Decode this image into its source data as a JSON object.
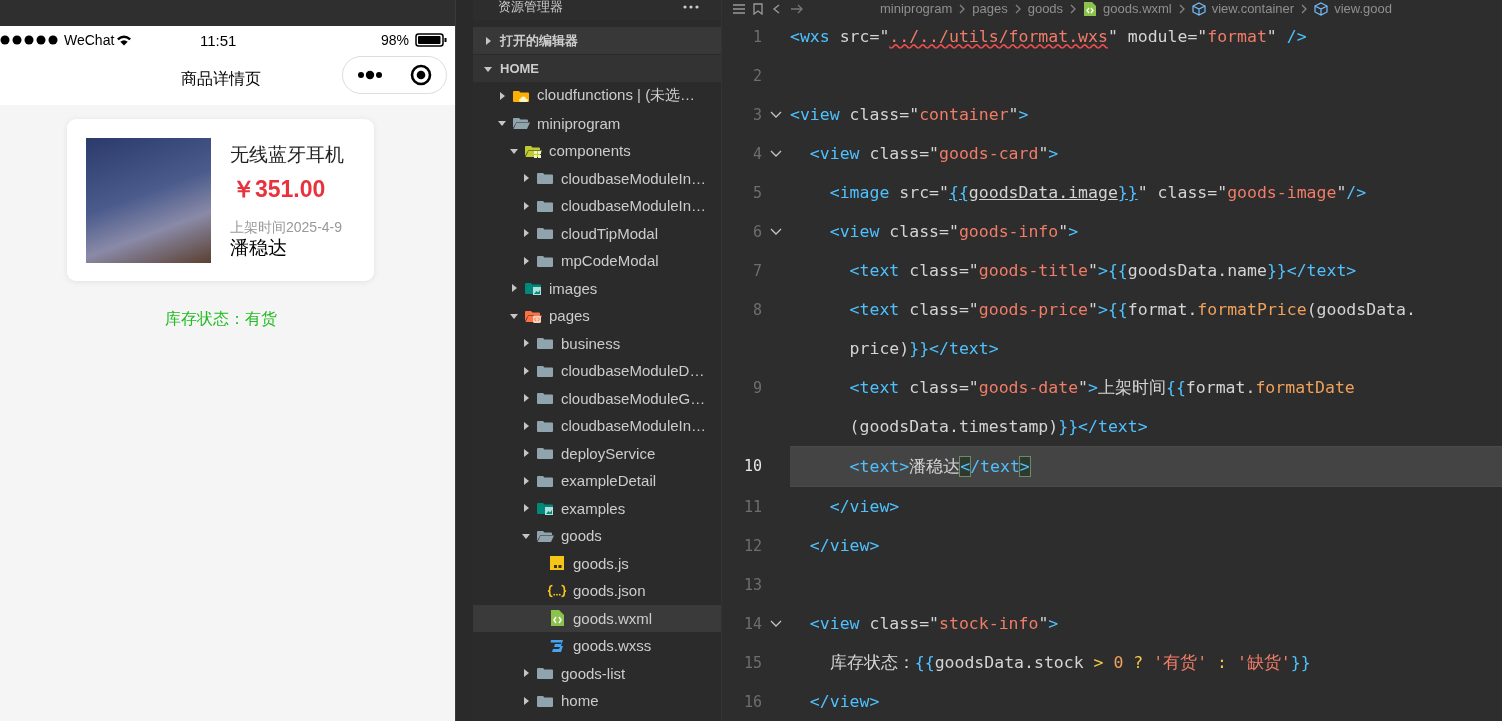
{
  "phone": {
    "status_bar": {
      "carrier": "WeChat",
      "time": "11:51",
      "battery": "98%"
    },
    "nav_title": "商品详情页",
    "product": {
      "title": "无线蓝牙耳机",
      "price": "￥351.00",
      "date": "上架时间2025-4-9",
      "note": "潘稳达"
    },
    "stock": "库存状态：有货"
  },
  "explorer": {
    "title": "资源管理器",
    "sections": [
      {
        "label": "打开的编辑器",
        "expanded": false
      },
      {
        "label": "HOME",
        "expanded": true
      }
    ],
    "tree": [
      {
        "name": "cloudfunctions | (未选…",
        "kind": "folder-cloud",
        "expanded": false,
        "selected": false
      },
      {
        "name": "miniprogram",
        "kind": "folder",
        "expanded": true,
        "selected": false,
        "children": [
          {
            "name": "components",
            "kind": "folder-components",
            "expanded": true,
            "selected": false,
            "children": [
              {
                "name": "cloudbaseModuleIn…",
                "kind": "folder",
                "expanded": false,
                "selected": false
              },
              {
                "name": "cloudbaseModuleIn…",
                "kind": "folder",
                "expanded": false,
                "selected": false
              },
              {
                "name": "cloudTipModal",
                "kind": "folder",
                "expanded": false,
                "selected": false
              },
              {
                "name": "mpCodeModal",
                "kind": "folder",
                "expanded": false,
                "selected": false
              }
            ]
          },
          {
            "name": "images",
            "kind": "folder-images",
            "expanded": false,
            "selected": false
          },
          {
            "name": "pages",
            "kind": "folder-pages",
            "expanded": true,
            "selected": false,
            "children": [
              {
                "name": "business",
                "kind": "folder",
                "expanded": false,
                "selected": false
              },
              {
                "name": "cloudbaseModuleD…",
                "kind": "folder",
                "expanded": false,
                "selected": false
              },
              {
                "name": "cloudbaseModuleG…",
                "kind": "folder",
                "expanded": false,
                "selected": false
              },
              {
                "name": "cloudbaseModuleIn…",
                "kind": "folder",
                "expanded": false,
                "selected": false
              },
              {
                "name": "deployService",
                "kind": "folder",
                "expanded": false,
                "selected": false
              },
              {
                "name": "exampleDetail",
                "kind": "folder",
                "expanded": false,
                "selected": false
              },
              {
                "name": "examples",
                "kind": "folder-images",
                "expanded": false,
                "selected": false
              },
              {
                "name": "goods",
                "kind": "folder",
                "expanded": true,
                "selected": false,
                "children": [
                  {
                    "name": "goods.js",
                    "kind": "js",
                    "selected": false
                  },
                  {
                    "name": "goods.json",
                    "kind": "json",
                    "selected": false
                  },
                  {
                    "name": "goods.wxml",
                    "kind": "wxml",
                    "selected": true
                  },
                  {
                    "name": "goods.wxss",
                    "kind": "wxss",
                    "selected": false
                  }
                ]
              },
              {
                "name": "goods-list",
                "kind": "folder",
                "expanded": false,
                "selected": false
              },
              {
                "name": "home",
                "kind": "folder",
                "expanded": false,
                "selected": false
              }
            ]
          }
        ]
      }
    ]
  },
  "editor": {
    "breadcrumb": [
      {
        "label": "miniprogram",
        "kind": "folder"
      },
      {
        "label": "pages",
        "kind": "folder"
      },
      {
        "label": "goods",
        "kind": "folder"
      },
      {
        "label": "goods.wxml",
        "kind": "file"
      },
      {
        "label": "view.container",
        "kind": "symbol"
      },
      {
        "label": "view.good",
        "kind": "symbol"
      }
    ],
    "lines": [
      {
        "number": "1",
        "foldable": false,
        "active": false,
        "rows": [
          {
            "tokens": [
              {
                "kind": "tag",
                "text": "<wxs"
              },
              {
                "kind": "attr",
                "text": " src=\""
              },
              {
                "kind": "strerr",
                "text": "../../utils/format.wxs"
              },
              {
                "kind": "attr",
                "text": "\" module=\""
              },
              {
                "kind": "str",
                "text": "format"
              },
              {
                "kind": "attr",
                "text": "\""
              },
              {
                "kind": "tag",
                "text": " />"
              }
            ]
          }
        ]
      },
      {
        "number": "2",
        "foldable": false,
        "active": false
      },
      {
        "number": "3",
        "foldable": true,
        "active": false,
        "rows": [
          {
            "tokens": [
              {
                "kind": "tag",
                "text": "<view"
              },
              {
                "kind": "attr",
                "text": " class=\""
              },
              {
                "kind": "str",
                "text": "container"
              },
              {
                "kind": "attr",
                "text": "\""
              },
              {
                "kind": "tag",
                "text": ">"
              }
            ]
          }
        ]
      },
      {
        "number": "4",
        "foldable": true,
        "active": false,
        "rows": [
          {
            "tokens": [
              {
                "kind": "tag",
                "text": "  <view"
              },
              {
                "kind": "attr",
                "text": " class=\""
              },
              {
                "kind": "str",
                "text": "goods-card"
              },
              {
                "kind": "attr",
                "text": "\""
              },
              {
                "kind": "tag",
                "text": ">"
              }
            ]
          }
        ]
      },
      {
        "number": "5",
        "foldable": false,
        "active": false,
        "rows": [
          {
            "tokens": [
              {
                "kind": "tag",
                "text": "    <image"
              },
              {
                "kind": "attr",
                "text": " src=\""
              },
              {
                "kind": "ubrace",
                "text": "{{"
              },
              {
                "kind": "uplain",
                "text": "goodsData.image"
              },
              {
                "kind": "ubrace",
                "text": "}}"
              },
              {
                "kind": "attr",
                "text": "\" class=\""
              },
              {
                "kind": "str",
                "text": "goods-image"
              },
              {
                "kind": "attr",
                "text": "\""
              },
              {
                "kind": "tag",
                "text": "/>"
              }
            ]
          }
        ]
      },
      {
        "number": "6",
        "foldable": true,
        "active": false,
        "rows": [
          {
            "tokens": [
              {
                "kind": "tag",
                "text": "    <view"
              },
              {
                "kind": "attr",
                "text": " class=\""
              },
              {
                "kind": "str",
                "text": "goods-info"
              },
              {
                "kind": "attr",
                "text": "\""
              },
              {
                "kind": "tag",
                "text": ">"
              }
            ]
          }
        ]
      },
      {
        "number": "7",
        "foldable": false,
        "active": false,
        "rows": [
          {
            "tokens": [
              {
                "kind": "tag",
                "text": "      <text"
              },
              {
                "kind": "attr",
                "text": " class=\""
              },
              {
                "kind": "str",
                "text": "goods-title"
              },
              {
                "kind": "attr",
                "text": "\""
              },
              {
                "kind": "tag",
                "text": ">"
              },
              {
                "kind": "brace",
                "text": "{{"
              },
              {
                "kind": "plain",
                "text": "goodsData.name"
              },
              {
                "kind": "brace",
                "text": "}}"
              },
              {
                "kind": "tag",
                "text": "</text>"
              }
            ]
          }
        ]
      },
      {
        "number": "8",
        "foldable": false,
        "active": false,
        "rows": [
          {
            "tokens": [
              {
                "kind": "tag",
                "text": "      <text"
              },
              {
                "kind": "attr",
                "text": " class=\""
              },
              {
                "kind": "str",
                "text": "goods-price"
              },
              {
                "kind": "attr",
                "text": "\""
              },
              {
                "kind": "tag",
                "text": ">"
              },
              {
                "kind": "brace",
                "text": "{{"
              },
              {
                "kind": "plain",
                "text": "format."
              },
              {
                "kind": "func",
                "text": "formatPrice"
              },
              {
                "kind": "plain",
                "text": "(goodsData."
              }
            ]
          },
          {
            "tokens": [
              {
                "kind": "plain",
                "text": "      price)"
              },
              {
                "kind": "brace",
                "text": "}}"
              },
              {
                "kind": "tag",
                "text": "</text>"
              }
            ]
          }
        ]
      },
      {
        "number": "9",
        "foldable": false,
        "active": false,
        "rows": [
          {
            "tokens": [
              {
                "kind": "tag",
                "text": "      <text"
              },
              {
                "kind": "attr",
                "text": " class=\""
              },
              {
                "kind": "str",
                "text": "goods-date"
              },
              {
                "kind": "attr",
                "text": "\""
              },
              {
                "kind": "tag",
                "text": ">"
              },
              {
                "kind": "plain",
                "text": "上架时间"
              },
              {
                "kind": "brace",
                "text": "{{"
              },
              {
                "kind": "plain",
                "text": "format."
              },
              {
                "kind": "func",
                "text": "formatDate"
              }
            ]
          },
          {
            "tokens": [
              {
                "kind": "plain",
                "text": "      (goodsData.timestamp)"
              },
              {
                "kind": "brace",
                "text": "}}"
              },
              {
                "kind": "tag",
                "text": "</text>"
              }
            ]
          }
        ]
      },
      {
        "number": "10",
        "foldable": false,
        "active": true,
        "rows": [
          {
            "tokens": [
              {
                "kind": "tag",
                "text": "      <text>"
              },
              {
                "kind": "plain",
                "text": "潘稳达"
              },
              {
                "kind": "match",
                "text": "<"
              },
              {
                "kind": "tag",
                "text": "/text"
              },
              {
                "kind": "match",
                "text": ">"
              }
            ]
          }
        ]
      },
      {
        "number": "11",
        "foldable": false,
        "active": false,
        "rows": [
          {
            "tokens": [
              {
                "kind": "tag",
                "text": "    </view>"
              }
            ]
          }
        ]
      },
      {
        "number": "12",
        "foldable": false,
        "active": false,
        "rows": [
          {
            "tokens": [
              {
                "kind": "tag",
                "text": "  </view>"
              }
            ]
          }
        ]
      },
      {
        "number": "13",
        "foldable": false,
        "active": false
      },
      {
        "number": "14",
        "foldable": true,
        "active": false,
        "rows": [
          {
            "tokens": [
              {
                "kind": "tag",
                "text": "  <view"
              },
              {
                "kind": "attr",
                "text": " class=\""
              },
              {
                "kind": "str",
                "text": "stock-info"
              },
              {
                "kind": "attr",
                "text": "\""
              },
              {
                "kind": "tag",
                "text": ">"
              }
            ]
          }
        ]
      },
      {
        "number": "15",
        "foldable": false,
        "active": false,
        "rows": [
          {
            "tokens": [
              {
                "kind": "plain",
                "text": "    库存状态："
              },
              {
                "kind": "brace",
                "text": "{{"
              },
              {
                "kind": "plain",
                "text": "goodsData.stock "
              },
              {
                "kind": "op",
                "text": ">"
              },
              {
                "kind": "num",
                "text": " 0"
              },
              {
                "kind": "op",
                "text": " ?"
              },
              {
                "kind": "str",
                "text": " '有货'"
              },
              {
                "kind": "op",
                "text": " :"
              },
              {
                "kind": "str",
                "text": " '缺货'"
              },
              {
                "kind": "brace",
                "text": "}}"
              }
            ]
          }
        ]
      },
      {
        "number": "16",
        "foldable": false,
        "active": false,
        "rows": [
          {
            "tokens": [
              {
                "kind": "tag",
                "text": "  </view>"
              }
            ]
          }
        ]
      }
    ]
  }
}
